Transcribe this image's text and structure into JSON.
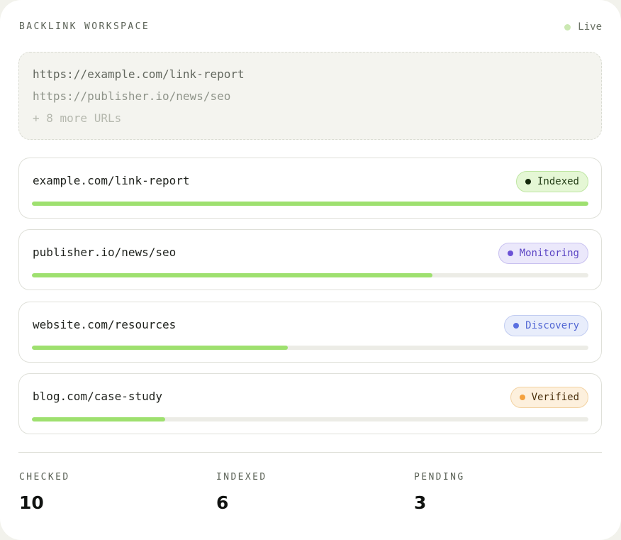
{
  "header": {
    "brand": "BACKLINK WORKSPACE",
    "status_label": "Live",
    "status_color": "#cbe8b2"
  },
  "url_input": {
    "lines": [
      "https://example.com/link-report",
      "https://publisher.io/news/seo",
      "+ 8 more URLs"
    ]
  },
  "links": [
    {
      "domain": "example.com/link-report",
      "status": "Indexed",
      "progress_percent": 100,
      "badge_bg": "#e5f7d5",
      "badge_border": "#bfe6a3",
      "badge_text": "#1f3a12",
      "dot": "#15280c"
    },
    {
      "domain": "publisher.io/news/seo",
      "status": "Monitoring",
      "progress_percent": 72,
      "badge_bg": "#ebe8fb",
      "badge_border": "#c8c0f0",
      "badge_text": "#5b45c4",
      "dot": "#6b52d6"
    },
    {
      "domain": "website.com/resources",
      "status": "Discovery",
      "progress_percent": 46,
      "badge_bg": "#e8edfb",
      "badge_border": "#c2cdf1",
      "badge_text": "#5267d4",
      "dot": "#5b70e0"
    },
    {
      "domain": "blog.com/case-study",
      "status": "Verified",
      "progress_percent": 24,
      "badge_bg": "#fdf0dd",
      "badge_border": "#f2d2a2",
      "badge_text": "#4a2f0c",
      "dot": "#f4a13d"
    }
  ],
  "progress_color": "#9ee06f",
  "stats": [
    {
      "label": "CHECKED",
      "value": "10"
    },
    {
      "label": "INDEXED",
      "value": "6"
    },
    {
      "label": "PENDING",
      "value": "3"
    }
  ]
}
